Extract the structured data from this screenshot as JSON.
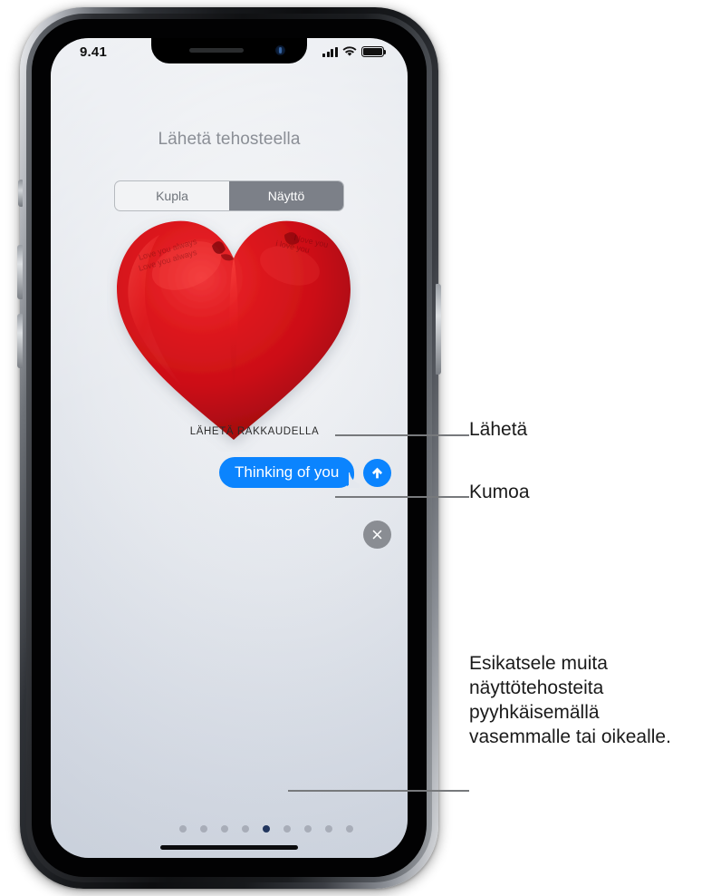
{
  "device": {
    "type": "iphone-x",
    "frame_color": "#0d0e10",
    "buttons": {
      "silent_switch": "silent-switch",
      "volume_up": "volume-up-button",
      "volume_down": "volume-down-button",
      "side_button": "side-button"
    }
  },
  "status_bar": {
    "time": "9.41",
    "cellular_icon": "cellular-signal-icon",
    "wifi_icon": "wifi-icon",
    "battery_icon": "battery-icon",
    "battery_level": 100
  },
  "screen": {
    "title": "Lähetä tehosteella",
    "background_color": "#e0e4ea",
    "segmented_control": {
      "options": [
        {
          "label": "Kupla",
          "selected": false
        },
        {
          "label": "Näyttö",
          "selected": true
        }
      ],
      "selected_index": 1,
      "selected_bg": "#7c8088",
      "selected_text_color": "#ffffff",
      "unselected_text_color": "#6f747b"
    },
    "effect": {
      "name": "heart-balloon",
      "caption": "LÄHETÄ RAKKAUDELLA",
      "color": "#cc0f16"
    },
    "message_bubble": {
      "text": "Thinking of you",
      "bg_color": "#0b84fe",
      "text_color": "#ffffff"
    },
    "send_button": {
      "icon": "arrow-up-icon",
      "color": "#0b84fe"
    },
    "cancel_button": {
      "icon": "close-x-icon",
      "color": "#8a8d93"
    },
    "page_dots": {
      "count": 9,
      "active_index": 4,
      "dot_color": "#a8adb8",
      "active_color": "#22365e"
    },
    "home_indicator": "home-indicator"
  },
  "callouts": {
    "send": "Lähetä",
    "cancel": "Kumoa",
    "swipe": "Esikatsele muita näyttötehosteita pyyhkäisemällä vasemmalle tai oikealle.",
    "leader_color": "#77797c"
  }
}
